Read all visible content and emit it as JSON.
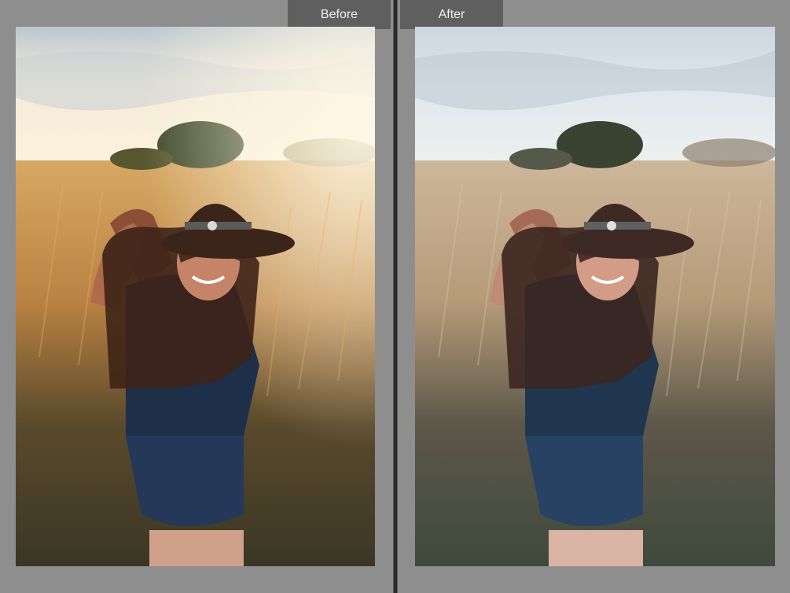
{
  "comparison": {
    "before_label": "Before",
    "after_label": "After"
  },
  "colors": {
    "panel_background": "#8e8e8e",
    "label_tab": "#5f5f5f",
    "divider": "#2a2a2a",
    "before_sky": "#f3ead8",
    "before_grass": "#c99a55",
    "after_sky": "#dfe8ee",
    "after_grass": "#b59a78"
  },
  "photos": {
    "before_subject": "woman-in-hat-photo",
    "after_subject": "woman-in-hat-photo"
  }
}
